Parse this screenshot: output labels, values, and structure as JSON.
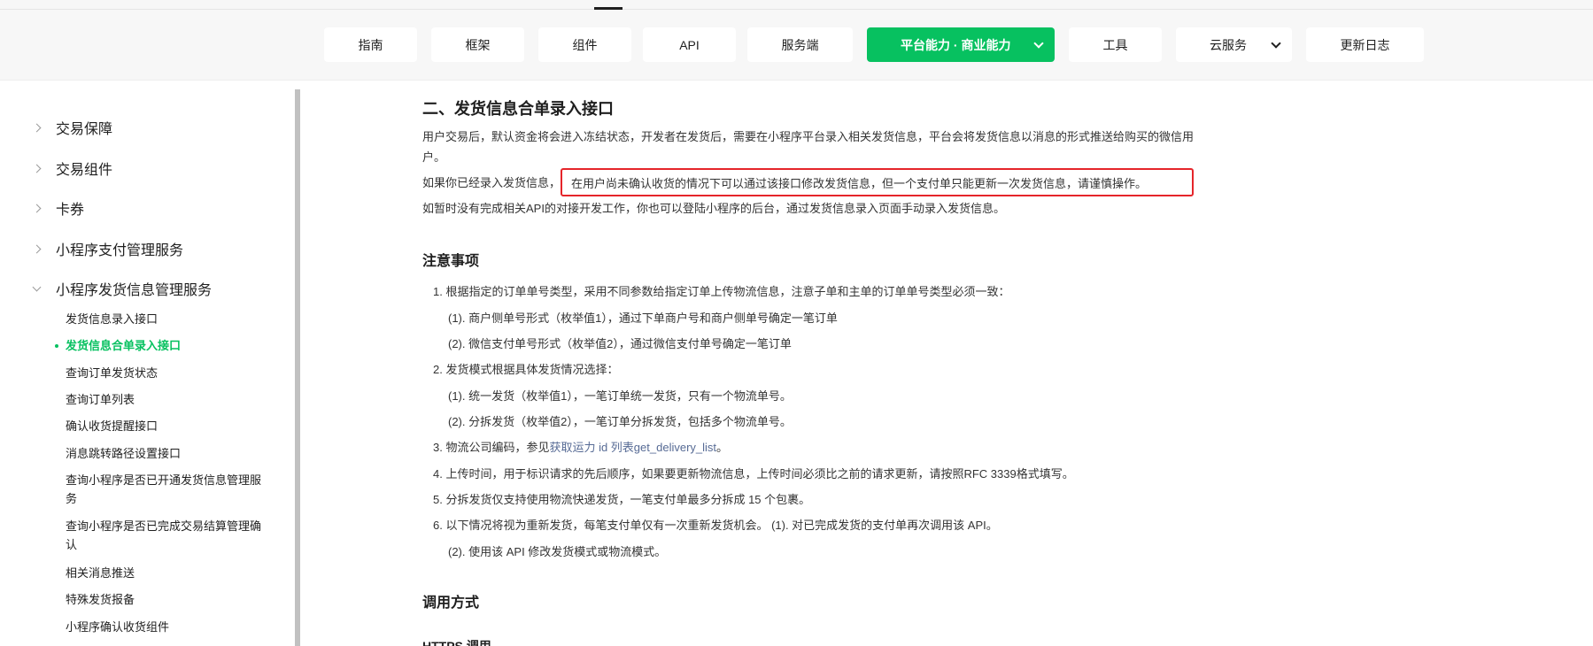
{
  "nav": {
    "items": [
      {
        "label": "指南"
      },
      {
        "label": "框架"
      },
      {
        "label": "组件"
      },
      {
        "label": "API"
      },
      {
        "label": "服务端"
      },
      {
        "label": "平台能力 · 商业能力"
      },
      {
        "label": "工具"
      },
      {
        "label": "云服务"
      },
      {
        "label": "更新日志"
      }
    ],
    "active_index": 5,
    "active_color": "#07c160"
  },
  "sidebar": {
    "sections": [
      {
        "label": "交易保障"
      },
      {
        "label": "交易组件"
      },
      {
        "label": "卡券"
      },
      {
        "label": "小程序支付管理服务"
      },
      {
        "label": "小程序发货信息管理服务"
      }
    ],
    "sub_items": [
      {
        "label": "发货信息录入接口"
      },
      {
        "label": "发货信息合单录入接口"
      },
      {
        "label": "查询订单发货状态"
      },
      {
        "label": "查询订单列表"
      },
      {
        "label": "确认收货提醒接口"
      },
      {
        "label": "消息跳转路径设置接口"
      },
      {
        "label": "查询小程序是否已开通发货信息管理服务"
      },
      {
        "label": "查询小程序是否已完成交易结算管理确认"
      },
      {
        "label": "相关消息推送"
      },
      {
        "label": "特殊发货报备"
      },
      {
        "label": "小程序确认收货组件"
      }
    ],
    "active_sub_index": 1
  },
  "content": {
    "title": "二、发货信息合单录入接口",
    "intro_line1": "用户交易后，默认资金将会进入冻结状态，开发者在发货后，需要在小程序平台录入相关发货信息，平台会将发货信息以消息的形式推送给购买的微信用",
    "intro_line2": "户。",
    "intro_prefix": "如果你已经录入发货信息，",
    "intro_highlight": "在用户尚未确认收货的情况下可以通过该接口修改发货信息，但一个支付单只能更新一次发货信息，请谨慎操作。",
    "intro_line4": "如暂时没有完成相关API的对接开发工作，你也可以登陆小程序的后台，通过发货信息录入页面手动录入发货信息。",
    "notes_title": "注意事项",
    "notes": {
      "n1": "1. 根据指定的订单单号类型，采用不同参数给指定订单上传物流信息，注意子单和主单的订单单号类型必须一致：",
      "n1a": "(1). 商户侧单号形式（枚举值1），通过下单商户号和商户侧单号确定一笔订单",
      "n1b": "(2). 微信支付单号形式（枚举值2），通过微信支付单号确定一笔订单",
      "n2": "2. 发货模式根据具体发货情况选择：",
      "n2a": "(1). 统一发货（枚举值1），一笔订单统一发货，只有一个物流单号。",
      "n2b": "(2). 分拆发货（枚举值2），一笔订单分拆发货，包括多个物流单号。",
      "n3_prefix": "3. 物流公司编码，参见",
      "n3_link": "获取运力 id 列表get_delivery_list",
      "n3_suffix": "。",
      "n4": "4. 上传时间，用于标识请求的先后顺序，如果要更新物流信息，上传时间必须比之前的请求更新，请按照RFC 3339格式填写。",
      "n5": "5. 分拆发货仅支持使用物流快递发货，一笔支付单最多分拆成 15 个包裹。",
      "n6": "6. 以下情况将视为重新发货，每笔支付单仅有一次重新发货机会。 (1). 对已完成发货的支付单再次调用该 API。",
      "n6a": "(2). 使用该 API 修改发货模式或物流模式。"
    },
    "call_title": "调用方式",
    "cut_heading": "HTTPS 调用"
  }
}
